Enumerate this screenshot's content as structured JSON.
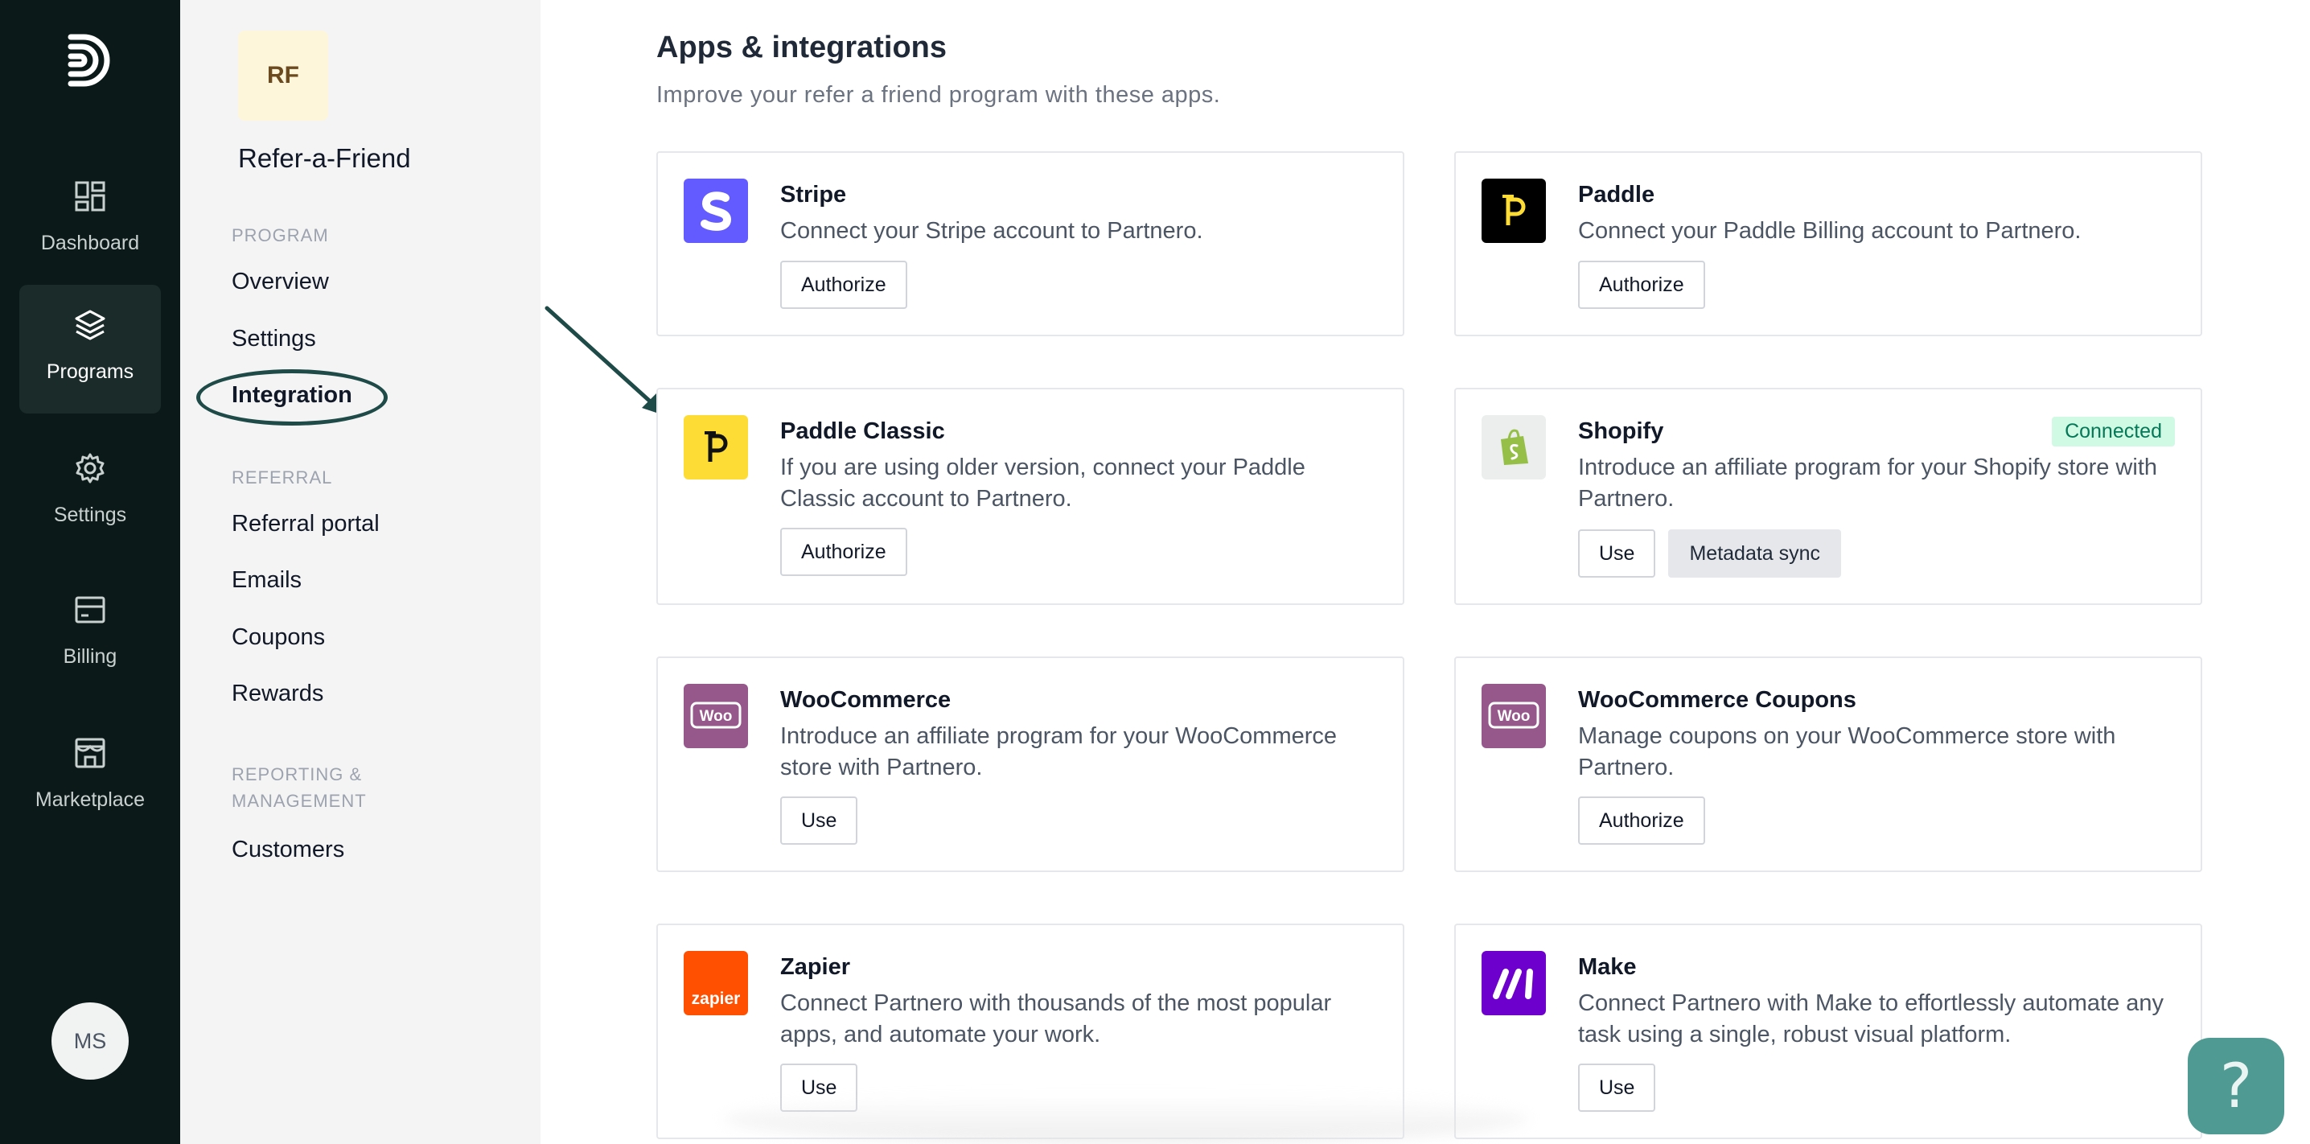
{
  "rail": {
    "items": [
      {
        "label": "Dashboard",
        "icon": "dashboard-icon"
      },
      {
        "label": "Programs",
        "icon": "layers-icon",
        "active": true
      },
      {
        "label": "Settings",
        "icon": "gear-icon"
      },
      {
        "label": "Billing",
        "icon": "billing-icon"
      },
      {
        "label": "Marketplace",
        "icon": "store-icon"
      }
    ],
    "avatar": "MS"
  },
  "program": {
    "badge": "RF",
    "name": "Refer-a-Friend",
    "sections": [
      {
        "heading": "PROGRAM",
        "links": [
          "Overview",
          "Settings",
          "Integration"
        ]
      },
      {
        "heading": "REFERRAL",
        "links": [
          "Referral portal",
          "Emails",
          "Coupons",
          "Rewards"
        ]
      },
      {
        "heading": "REPORTING & MANAGEMENT",
        "links": [
          "Customers"
        ]
      }
    ],
    "current": "Integration"
  },
  "main": {
    "title": "Apps & integrations",
    "subtitle": "Improve your refer a friend program with these apps.",
    "cards": [
      {
        "name": "Stripe",
        "desc": "Connect your Stripe account to Partnero.",
        "buttons": [
          "Authorize"
        ],
        "logo": "stripe-logo"
      },
      {
        "name": "Paddle",
        "desc": "Connect your Paddle Billing account to Partnero.",
        "buttons": [
          "Authorize"
        ],
        "logo": "paddle-logo"
      },
      {
        "name": "Paddle Classic",
        "desc": "If you are using older version, connect your Paddle Classic account to Partnero.",
        "buttons": [
          "Authorize"
        ],
        "logo": "paddle-classic-logo"
      },
      {
        "name": "Shopify",
        "desc": "Introduce an affiliate program for your Shopify store with Partnero.",
        "buttons": [
          "Use",
          "Metadata sync"
        ],
        "badge": "Connected",
        "logo": "shopify-logo"
      },
      {
        "name": "WooCommerce",
        "desc": "Introduce an affiliate program for your WooCommerce store with Partnero.",
        "buttons": [
          "Use"
        ],
        "logo": "woocommerce-logo"
      },
      {
        "name": "WooCommerce Coupons",
        "desc": "Manage coupons on your WooCommerce store with Partnero.",
        "buttons": [
          "Authorize"
        ],
        "logo": "woocommerce-logo"
      },
      {
        "name": "Zapier",
        "desc": "Connect Partnero with thousands of the most popular apps, and automate your work.",
        "buttons": [
          "Use"
        ],
        "logo": "zapier-logo"
      },
      {
        "name": "Make",
        "desc": "Connect Partnero with Make to effortlessly automate any task using a single, robust visual platform.",
        "buttons": [
          "Use"
        ],
        "logo": "make-logo"
      }
    ],
    "logo_text": {
      "zapier": "zapier",
      "woo": "Woo"
    }
  },
  "help": {
    "glyph": "?"
  },
  "colors": {
    "rail_bg": "#0b1a19",
    "subnav_bg": "#f4f4f4",
    "stripe": "#635bff",
    "paddle_black": "#000000",
    "paddle_yellow": "#fddd35",
    "woo": "#96588a",
    "zapier": "#ff4f00",
    "make": "#6d00cc",
    "shopify": "#95bf47",
    "connected_bg": "#d1fae5",
    "connected_fg": "#047857",
    "help": "#4f9a92"
  }
}
